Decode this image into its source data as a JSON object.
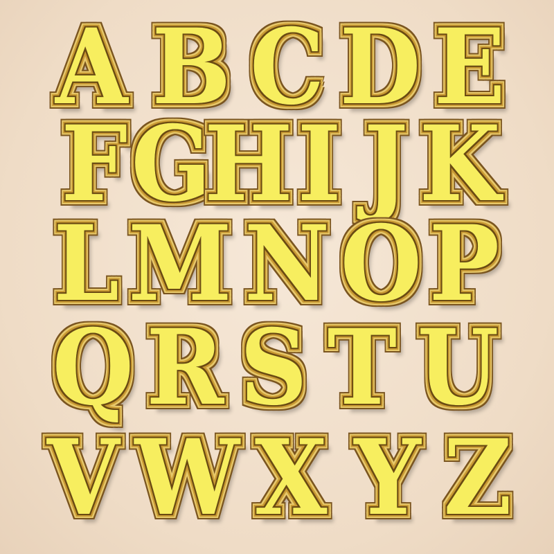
{
  "rows": [
    [
      "A",
      "B",
      "C",
      "D",
      "E"
    ],
    [
      "F",
      "G",
      "H",
      "I",
      "J",
      "K"
    ],
    [
      "L",
      "M",
      "N",
      "O",
      "P"
    ],
    [
      "Q",
      "R",
      "S",
      "T",
      "U"
    ],
    [
      "V",
      "W",
      "X",
      "Y",
      "Z"
    ]
  ],
  "colors": {
    "background": "#f2e2cf",
    "letter_fill": "#f7ee5f",
    "outline_gold": "#c99a33",
    "outline_dark": "#6b4a12"
  }
}
